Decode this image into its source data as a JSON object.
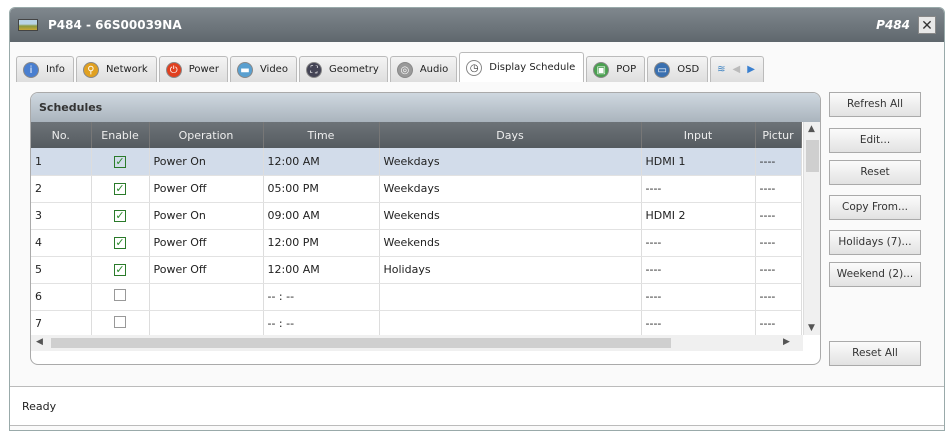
{
  "window": {
    "title": "P484 - 66S00039NA",
    "model": "P484",
    "close": "✕"
  },
  "tabs": [
    {
      "label": "Info",
      "icon": "info-icon"
    },
    {
      "label": "Network",
      "icon": "network-icon"
    },
    {
      "label": "Power",
      "icon": "power-icon"
    },
    {
      "label": "Video",
      "icon": "video-icon"
    },
    {
      "label": "Geometry",
      "icon": "geometry-icon"
    },
    {
      "label": "Audio",
      "icon": "audio-icon"
    },
    {
      "label": "Display Schedule",
      "icon": "clock-icon",
      "active": true
    },
    {
      "label": "POP",
      "icon": "pop-icon"
    },
    {
      "label": "OSD",
      "icon": "osd-icon"
    }
  ],
  "panel": {
    "title": "Schedules",
    "columns": [
      "No.",
      "Enable",
      "Operation",
      "Time",
      "Days",
      "Input",
      "Pictur"
    ],
    "rows": [
      {
        "no": "1",
        "enabled": true,
        "operation": "Power On",
        "time": "12:00 AM",
        "days": "Weekdays",
        "input": "HDMI 1",
        "picture": "----"
      },
      {
        "no": "2",
        "enabled": true,
        "operation": "Power Off",
        "time": "05:00 PM",
        "days": "Weekdays",
        "input": "----",
        "picture": "----"
      },
      {
        "no": "3",
        "enabled": true,
        "operation": "Power On",
        "time": "09:00 AM",
        "days": "Weekends",
        "input": "HDMI 2",
        "picture": "----"
      },
      {
        "no": "4",
        "enabled": true,
        "operation": "Power Off",
        "time": "12:00 PM",
        "days": "Weekends",
        "input": "----",
        "picture": "----"
      },
      {
        "no": "5",
        "enabled": true,
        "operation": "Power Off",
        "time": "12:00 AM",
        "days": "Holidays",
        "input": "----",
        "picture": "----"
      },
      {
        "no": "6",
        "enabled": false,
        "operation": "",
        "time": "-- : --",
        "days": "",
        "input": "----",
        "picture": "----"
      },
      {
        "no": "7",
        "enabled": false,
        "operation": "",
        "time": "-- : --",
        "days": "",
        "input": "----",
        "picture": "----"
      }
    ]
  },
  "buttons": {
    "refresh_all": "Refresh All",
    "edit": "Edit...",
    "reset": "Reset",
    "copy_from": "Copy From...",
    "holidays": "Holidays (7)...",
    "weekend": "Weekend (2)...",
    "reset_all": "Reset All"
  },
  "status": "Ready"
}
